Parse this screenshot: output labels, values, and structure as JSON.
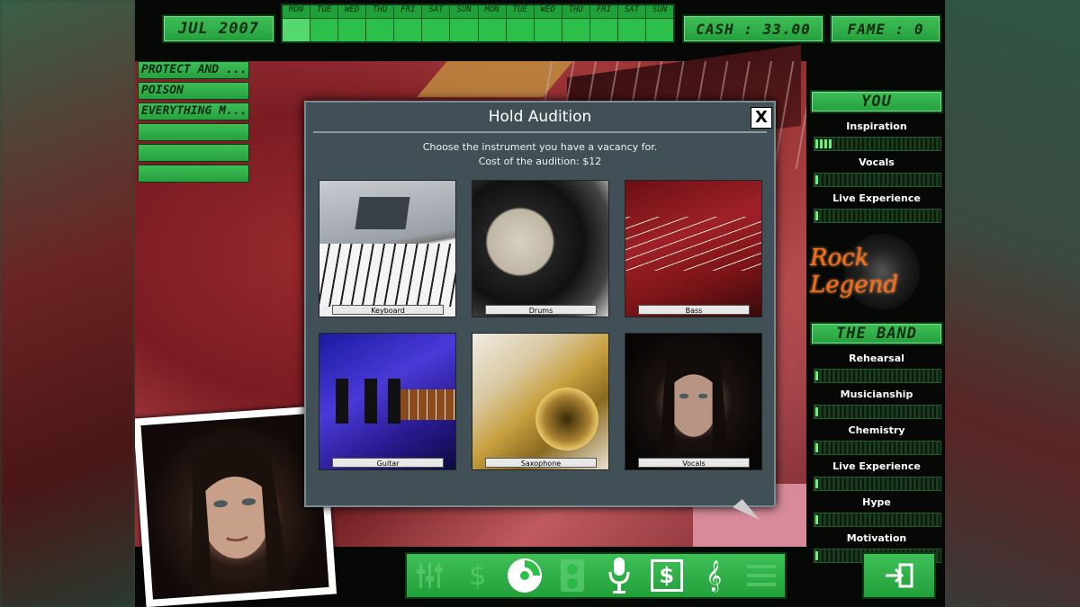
{
  "header": {
    "date": "JUL 2007",
    "cash": "CASH :  33.00",
    "fame": "FAME : 0"
  },
  "calendar": {
    "days": [
      "MON",
      "TUE",
      "WED",
      "THU",
      "FRI",
      "SAT",
      "SUN",
      "MON",
      "TUE",
      "WED",
      "THU",
      "FRI",
      "SAT",
      "SUN"
    ]
  },
  "songs": [
    "PROTECT AND ...",
    "POISON",
    "EVERYTHING M...",
    "",
    "",
    ""
  ],
  "you_panel": {
    "title": "YOU",
    "stats": [
      {
        "label": "Inspiration",
        "level": 0.13
      },
      {
        "label": "Vocals",
        "level": 0.02
      },
      {
        "label": "Live  Experience",
        "level": 0.02
      }
    ]
  },
  "logo": {
    "text": "Rock Legend"
  },
  "band_panel": {
    "title": "THE BAND",
    "stats": [
      {
        "label": "Rehearsal",
        "level": 0.02
      },
      {
        "label": "Musicianship",
        "level": 0.02
      },
      {
        "label": "Chemistry",
        "level": 0.02
      },
      {
        "label": "Live  Experience",
        "level": 0.02
      },
      {
        "label": "Hype",
        "level": 0.02
      },
      {
        "label": "Motivation",
        "level": 0.02
      }
    ]
  },
  "modal": {
    "title": "Hold Audition",
    "close_label": "X",
    "subtitle_line1": "Choose the instrument you have a vacancy for.",
    "subtitle_line2": "Cost of the audition: $12",
    "instruments": [
      "Keyboard",
      "Drums",
      "Bass",
      "Guitar",
      "Saxophone",
      "Vocals"
    ]
  },
  "toolbar": {
    "icons": [
      "mixer-icon",
      "money-icon",
      "cd-icon",
      "speaker-icon",
      "microphone-icon",
      "cash-register-icon",
      "treble-clef-icon",
      "list-icon"
    ],
    "money_symbol": "$",
    "register_symbol": "$",
    "clef_symbol": "𝄞"
  },
  "colors": {
    "accent_green": "#2cc04a",
    "modal_bg": "#415056",
    "logo_orange": "#ff6a1a"
  }
}
